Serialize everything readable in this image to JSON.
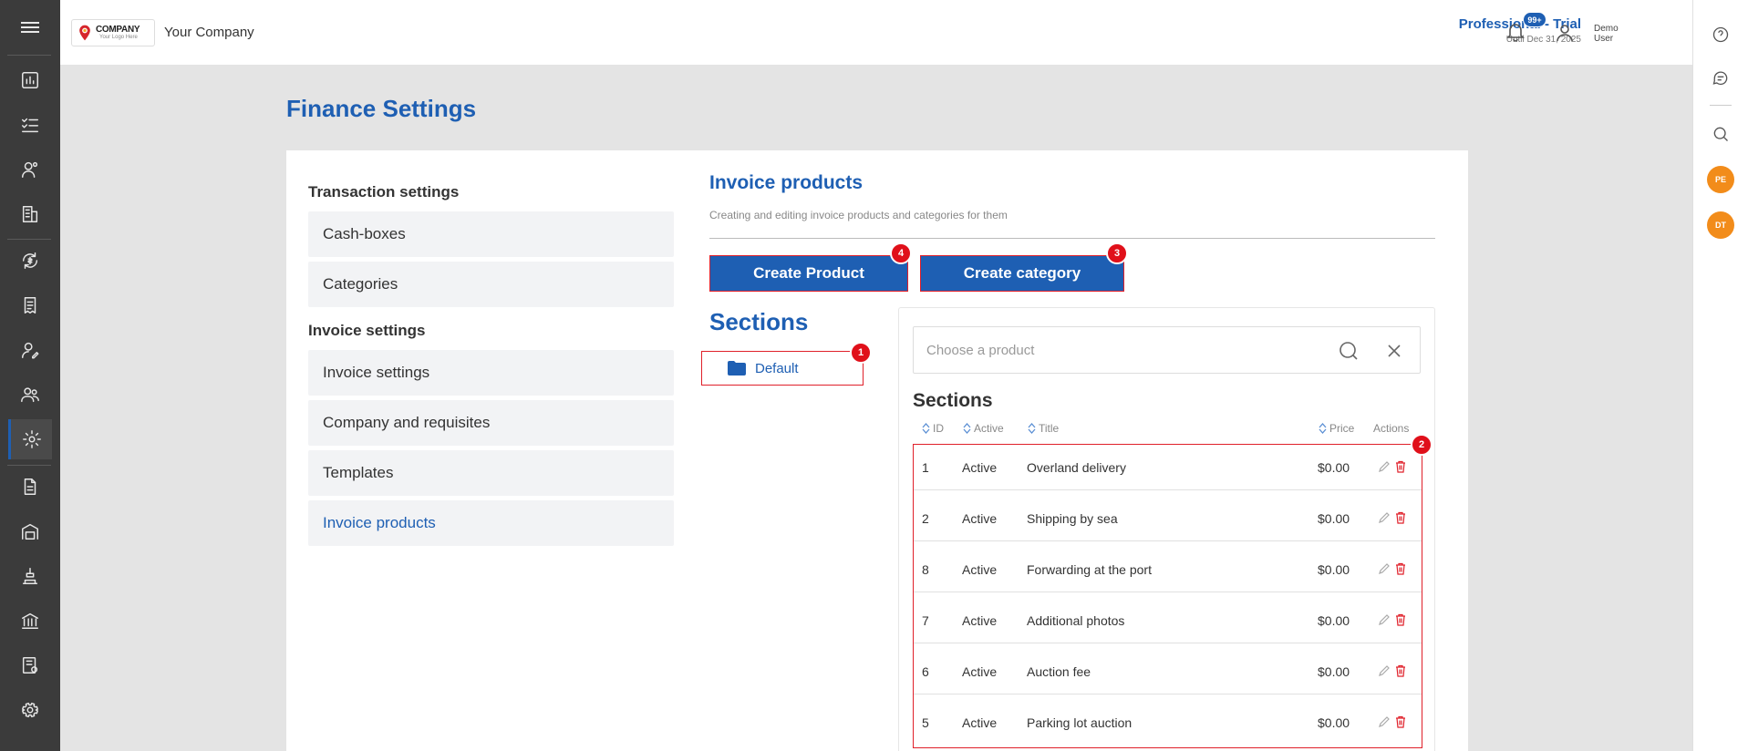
{
  "header": {
    "logo_text": "COMPANY",
    "logo_tagline": "Your Logo Here",
    "company_name": "Your Company",
    "plan_title": "Professional - Trial",
    "plan_until": "Until Dec 31, 2025",
    "notifications_badge": "99+",
    "user_name": "Demo User"
  },
  "right_rail": {
    "avatars": [
      "PE",
      "DT"
    ]
  },
  "page": {
    "title": "Finance Settings"
  },
  "settings_menu": {
    "transaction_group": "Transaction settings",
    "transaction_items": [
      "Cash-boxes",
      "Categories"
    ],
    "invoice_group": "Invoice settings",
    "invoice_items": [
      "Invoice settings",
      "Company and requisites",
      "Templates",
      "Invoice products"
    ]
  },
  "invoice_products": {
    "title": "Invoice products",
    "subtitle": "Creating and editing invoice products and categories for them",
    "create_product_label": "Create Product",
    "create_category_label": "Create category",
    "sections_title": "Sections",
    "folders": [
      "Default"
    ]
  },
  "product_panel": {
    "search_placeholder": "Choose a product",
    "title": "Sections",
    "columns": {
      "id": "ID",
      "active": "Active",
      "title": "Title",
      "price": "Price",
      "actions": "Actions"
    },
    "rows": [
      {
        "id": "1",
        "active": "Active",
        "title": "Overland delivery",
        "price": "$0.00"
      },
      {
        "id": "2",
        "active": "Active",
        "title": "Shipping by sea",
        "price": "$0.00"
      },
      {
        "id": "8",
        "active": "Active",
        "title": "Forwarding at the port",
        "price": "$0.00"
      },
      {
        "id": "7",
        "active": "Active",
        "title": "Additional photos",
        "price": "$0.00"
      },
      {
        "id": "6",
        "active": "Active",
        "title": "Auction fee",
        "price": "$0.00"
      },
      {
        "id": "5",
        "active": "Active",
        "title": "Parking lot auction",
        "price": "$0.00"
      }
    ]
  },
  "markers": [
    "1",
    "2",
    "3",
    "4"
  ],
  "colors": {
    "brand": "#1e5fb3",
    "marker": "#e0101a",
    "avatar": "#f28c1a",
    "rail": "#3b3b3b"
  }
}
